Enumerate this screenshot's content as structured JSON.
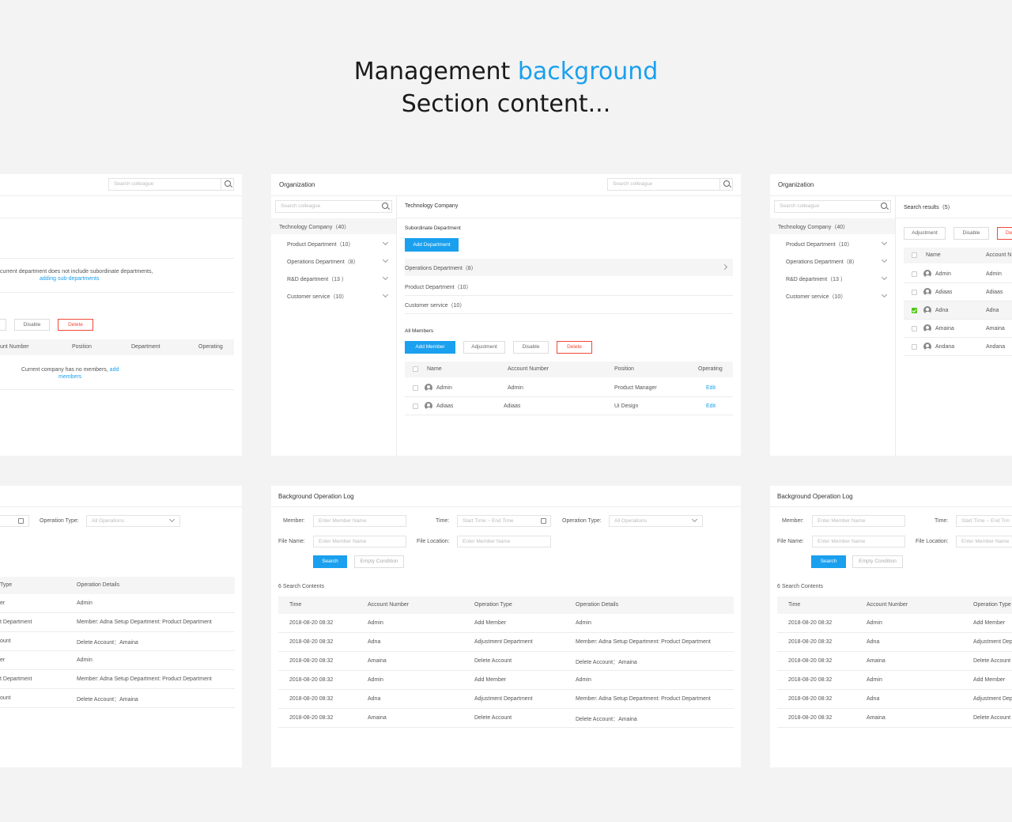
{
  "hero": {
    "line1_part1": "Management",
    "line1_accent": "background",
    "line2": "Section content..."
  },
  "colors": {
    "accent": "#1aa0ee",
    "danger": "#f04a3a",
    "check": "#52c41a",
    "background": "#f3f3f3"
  },
  "card_a": {
    "search_placeholder": "Search colleague",
    "empty_dept_text": "current department does not include subordinate departments,",
    "empty_dept_link": "adding sub-departments",
    "btn_disable": "Disable",
    "btn_delete": "Delete",
    "col_account": "unt Number",
    "col_position": "Position",
    "col_department": "Department",
    "col_operating": "Operating",
    "empty_members_text": "Current company has no members,",
    "empty_members_link1": "add",
    "empty_members_link2": "members"
  },
  "card_b": {
    "header_title": "Organization",
    "search_placeholder": "Search colleague",
    "left_search_placeholder": "Search colleague",
    "tree_root": "Technology Company（40）",
    "tree_items": [
      "Product Department（10）",
      "Operations Department（8）",
      "R&D department（13 ）",
      "Customer service（10）"
    ],
    "company_title": "Technology Company",
    "sub_dept_title": "Subordinate Department",
    "btn_add_dept": "Add Department",
    "dept_rows": [
      "Operations Department（8）",
      "Product Department（10）",
      "Customer service（10）"
    ],
    "all_members_title": "All Members",
    "btn_add_member": "Add Member",
    "btn_adjustment": "Adjustment",
    "btn_disable": "Disable",
    "btn_delete": "Delete",
    "col_name": "Name",
    "col_account": "Account Number",
    "col_position": "Position",
    "col_operating": "Operating",
    "members": [
      {
        "name": "Admin",
        "account": "Admin",
        "position": "Product Manager",
        "op": "Edit"
      },
      {
        "name": "Adiaas",
        "account": "Adiaas",
        "position": "Ui Design",
        "op": "Edit"
      }
    ]
  },
  "card_c": {
    "header_title": "Organization",
    "left_search_placeholder": "Search colleague",
    "tree_root": "Technology Company（40）",
    "tree_items": [
      "Product Department（10）",
      "Operations Department（8）",
      "R&D department（13 ）",
      "Customer service（10）"
    ],
    "results_title": "Search results（5）",
    "btn_adjustment": "Adjustment",
    "btn_disable": "Disable",
    "btn_delete_partial": "De",
    "col_name": "Name",
    "col_account_partial": "Account N",
    "rows": [
      {
        "name": "Admin",
        "account": "Admin",
        "checked": false
      },
      {
        "name": "Adiaas",
        "account": "Adiaas",
        "checked": false
      },
      {
        "name": "Adna",
        "account": "Adna",
        "checked": true
      },
      {
        "name": "Amaina",
        "account": "Amaina",
        "checked": false
      },
      {
        "name": "Andana",
        "account": "Andana",
        "checked": false
      }
    ]
  },
  "card_d": {
    "operation_type_label": "Operation Type:",
    "operation_type_value": "All Operations",
    "col_type_partial": "Type",
    "col_details": "Operation Details",
    "rows": [
      {
        "type": "er",
        "details": "Admin"
      },
      {
        "type": "t Department",
        "details": "Member: Adna    Setup Department: Product Department"
      },
      {
        "type": "ount",
        "details": "Delete Account：Amaina"
      },
      {
        "type": "er",
        "details": "Admin"
      },
      {
        "type": "t Department",
        "details": "Member: Adna    Setup Department: Product Department"
      },
      {
        "type": "ount",
        "details": "Delete Account：Amaina"
      }
    ]
  },
  "card_e": {
    "header_title": "Background Operation Log",
    "member_label": "Member:",
    "member_placeholder": "Enter Member Name",
    "time_label": "Time:",
    "time_placeholder": "Start Time ~ End Time",
    "operation_type_label": "Operation Type:",
    "operation_type_value": "All Operations",
    "file_name_label": "File Name:",
    "file_name_placeholder": "Enter Member Name",
    "file_location_label": "File Location:",
    "file_location_placeholder": "Enter Member Name",
    "btn_search": "Search",
    "btn_empty": "Empty Condition",
    "result_count": "6 Search Contents",
    "col_time": "Time",
    "col_account": "Account Number",
    "col_type": "Operation Type",
    "col_details": "Operation Details",
    "rows": [
      {
        "time": "2018-08-20  08:32",
        "account": "Admin",
        "type": "Add Member",
        "details": "Admin"
      },
      {
        "time": "2018-08-20  08:32",
        "account": "Adna",
        "type": "Adjustment Department",
        "details": "Member: Adna    Setup Department: Product Department"
      },
      {
        "time": "2018-08-20  08:32",
        "account": "Amaina",
        "type": "Delete Account",
        "details": "Delete Account：Amaina"
      },
      {
        "time": "2018-08-20  08:32",
        "account": "Admin",
        "type": "Add Member",
        "details": "Admin"
      },
      {
        "time": "2018-08-20  08:32",
        "account": "Adna",
        "type": "Adjustment Department",
        "details": "Member: Adna    Setup Department: Product Department"
      },
      {
        "time": "2018-08-20  08:32",
        "account": "Amaina",
        "type": "Delete Account",
        "details": "Delete Account：Amaina"
      }
    ]
  },
  "card_f": {
    "header_title": "Background Operation Log",
    "member_label": "Member:",
    "member_placeholder": "Enter Member Name",
    "time_label": "Time:",
    "time_placeholder": "Start Time ~ End Tim",
    "file_name_label": "File Name:",
    "file_name_placeholder": "Enter Member Name",
    "file_location_label": "File Location:",
    "file_location_placeholder": "Enter Member Name",
    "btn_search": "Search",
    "btn_empty": "Empty Condition",
    "result_count": "6 Search Contents",
    "col_time": "Time",
    "col_account": "Account Number",
    "col_type": "Operation Type",
    "rows": [
      {
        "time": "2018-08-20  08:32",
        "account": "Admin",
        "type": "Add Member"
      },
      {
        "time": "2018-08-20  08:32",
        "account": "Adna",
        "type": "Adjustment Depa"
      },
      {
        "time": "2018-08-20  08:32",
        "account": "Amaina",
        "type": "Delete Account"
      },
      {
        "time": "2018-08-20  08:32",
        "account": "Admin",
        "type": "Add Member"
      },
      {
        "time": "2018-08-20  08:32",
        "account": "Adna",
        "type": "Adjustment Depa"
      },
      {
        "time": "2018-08-20  08:32",
        "account": "Amaina",
        "type": "Delete Account"
      }
    ]
  }
}
